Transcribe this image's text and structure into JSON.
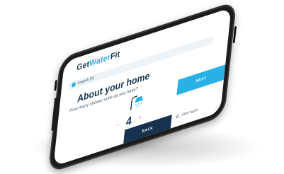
{
  "brand": {
    "part1": "Get",
    "part2": "Water",
    "part3": "Fit"
  },
  "language": {
    "label": "English (fr)"
  },
  "page": {
    "title": "About your home",
    "question": "How many shower units do you have?"
  },
  "stepper": {
    "minus": "−",
    "value": "4",
    "plus": "+"
  },
  "buttons": {
    "next": "NEXT",
    "back": "BACK",
    "start_again": "Start again"
  },
  "icons": {
    "shower": "shower-icon",
    "refresh": "refresh-icon",
    "flag": "flag-icon"
  },
  "colors": {
    "navy": "#16324f",
    "accent": "#29b1e5",
    "phone": "#1b1b1b"
  }
}
